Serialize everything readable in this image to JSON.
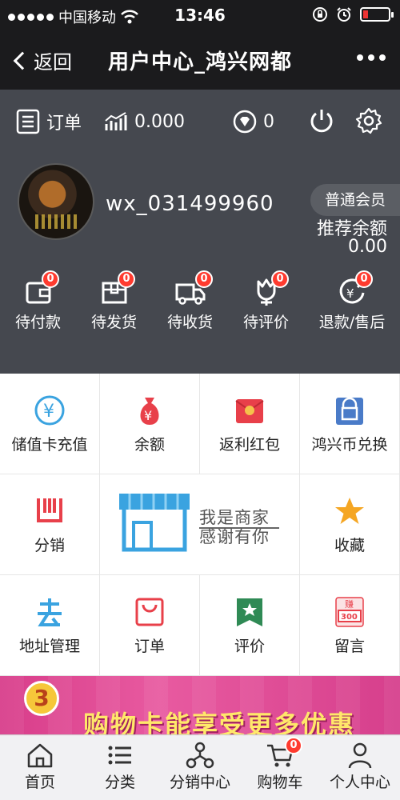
{
  "status_bar": {
    "carrier": "中国移动",
    "time": "13:46"
  },
  "nav": {
    "back_label": "返回",
    "title": "用户中心_鸿兴网都"
  },
  "profile": {
    "order_label": "订单",
    "points_value": "0.000",
    "diamond_value": "0",
    "username": "wx_031499960",
    "member_level": "普通会员",
    "recommend_label": "推荐余额",
    "recommend_value": "0.00"
  },
  "order_status": [
    {
      "label": "待付款",
      "count": "0"
    },
    {
      "label": "待发货",
      "count": "0"
    },
    {
      "label": "待收货",
      "count": "0"
    },
    {
      "label": "待评价",
      "count": "0"
    },
    {
      "label": "退款/售后",
      "count": "0"
    }
  ],
  "grid": {
    "stored_card": "储值卡充值",
    "balance": "余额",
    "rebate": "返利红包",
    "coin_exchange": "鸿兴币兑换",
    "distribution": "分销",
    "merchant_line1": "我是商家",
    "merchant_line2": "感谢有你",
    "favorites": "收藏",
    "address": "地址管理",
    "orders": "订单",
    "reviews": "评价",
    "messages": "留言",
    "msg_icon_top": "赚",
    "msg_icon_num": "300"
  },
  "banner": {
    "number": "3",
    "text": "购物卡能享受更多优惠"
  },
  "tabbar": {
    "home": "首页",
    "category": "分类",
    "distribution_center": "分销中心",
    "cart": "购物车",
    "cart_count": "0",
    "personal": "个人中心"
  },
  "colors": {
    "header": "#1b1b1d",
    "profile_bg": "#45484f",
    "badge": "#ff3b2f",
    "accent_blue": "#3aa3e0",
    "accent_red": "#e8404a"
  }
}
